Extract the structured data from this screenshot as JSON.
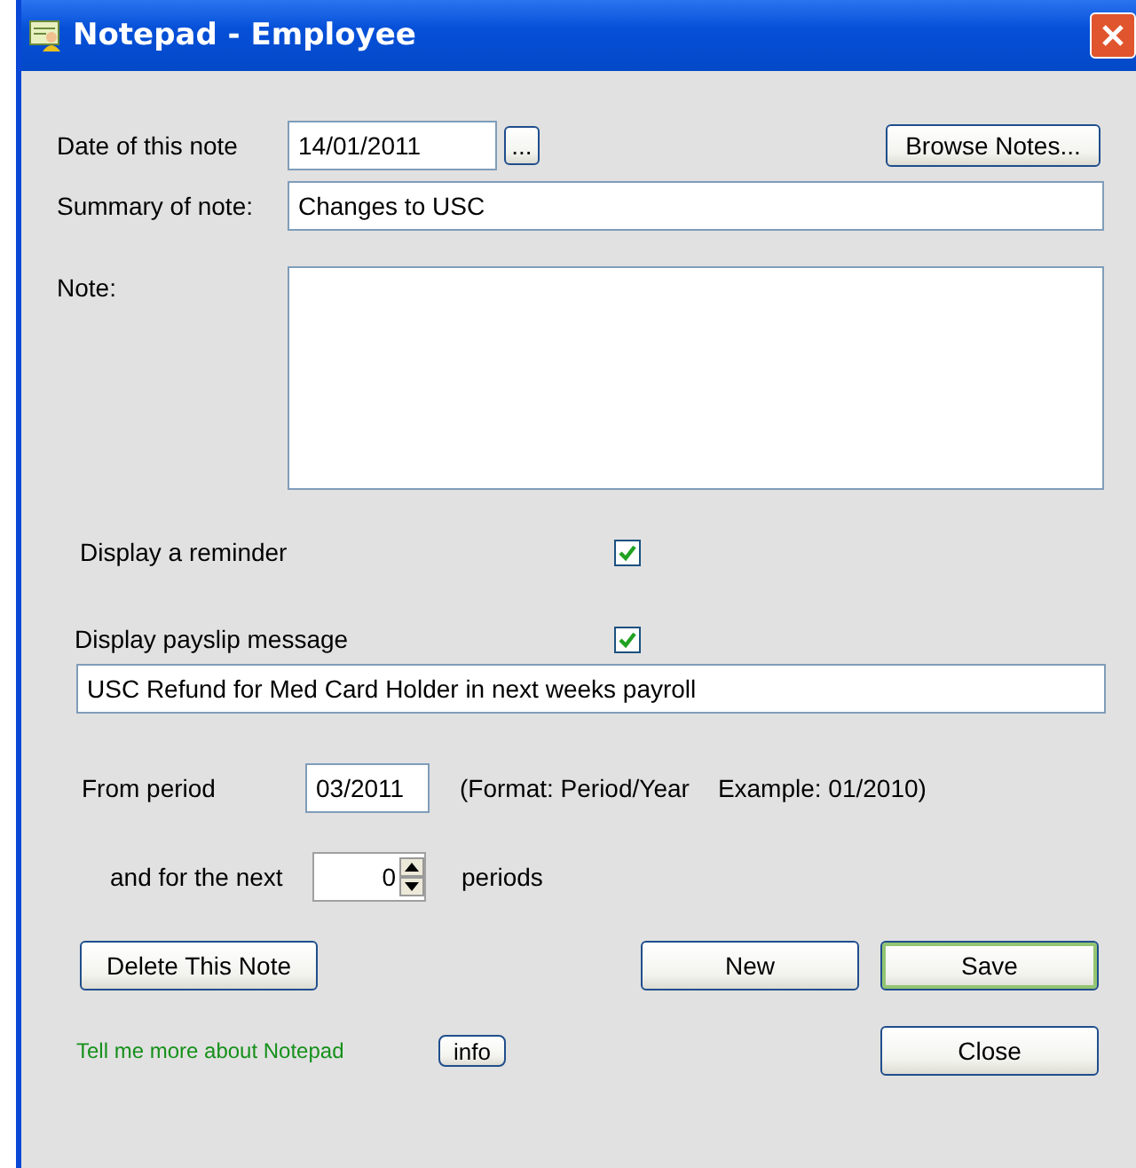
{
  "window": {
    "title": "Notepad - Employee"
  },
  "date": {
    "label": "Date of this note",
    "value": "14/01/2011",
    "picker": "...",
    "browse": {
      "label": "Browse Notes...",
      "default": false
    }
  },
  "summary": {
    "label": "Summary of note:",
    "value": "Changes to USC"
  },
  "note": {
    "label": "Note:"
  },
  "options": [
    {
      "label": "Display a reminder",
      "checked": true
    },
    {
      "label": "Display payslip message",
      "checked": true
    }
  ],
  "payslip_message": {
    "value": "USC Refund for Med Card Holder in next weeks payroll"
  },
  "from_period": {
    "label": "From period",
    "value": "03/2011",
    "format": "(Format: Period/Year",
    "example": "Example:  01/2010)"
  },
  "next": {
    "label": "and for the next",
    "value": "0",
    "unit": "periods"
  },
  "actions": [
    {
      "label": "Delete This Note",
      "default": false
    },
    {
      "label": "New",
      "default": false
    },
    {
      "label": "Save",
      "default": true
    }
  ],
  "help": {
    "text": "Tell me more about  Notepad",
    "button": "info"
  },
  "close": {
    "label": "Close",
    "default": false
  }
}
